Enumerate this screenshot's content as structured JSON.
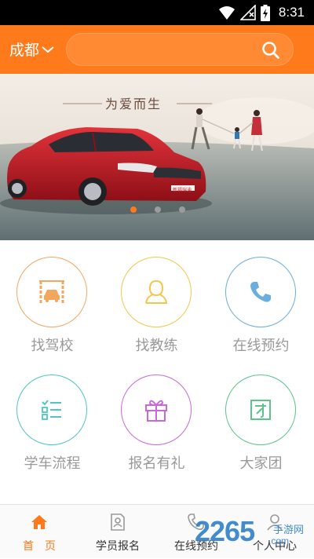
{
  "status_bar": {
    "time": "8:31"
  },
  "header": {
    "city": "成都",
    "search_placeholder": ""
  },
  "banner": {
    "slogan": "为爱而生",
    "plate": "新福瑞迪"
  },
  "menu": [
    {
      "label": "找驾校",
      "color": "#f2a75f"
    },
    {
      "label": "找教练",
      "color": "#f4c64e"
    },
    {
      "label": "在线预约",
      "color": "#6aaee0"
    },
    {
      "label": "学车流程",
      "color": "#4ec7c2"
    },
    {
      "label": "报名有礼",
      "color": "#c76ad8"
    },
    {
      "label": "大家团",
      "color": "#5cc48a"
    }
  ],
  "bottom_nav": [
    {
      "label": "首　页",
      "active": true
    },
    {
      "label": "学员报名",
      "active": false
    },
    {
      "label": "在线预约",
      "active": false
    },
    {
      "label": "个人中心",
      "active": false
    }
  ],
  "watermark": {
    "number": "2265",
    "suffix": ".com",
    "site": "手游网"
  },
  "colors": {
    "accent": "#ff7a1a"
  }
}
